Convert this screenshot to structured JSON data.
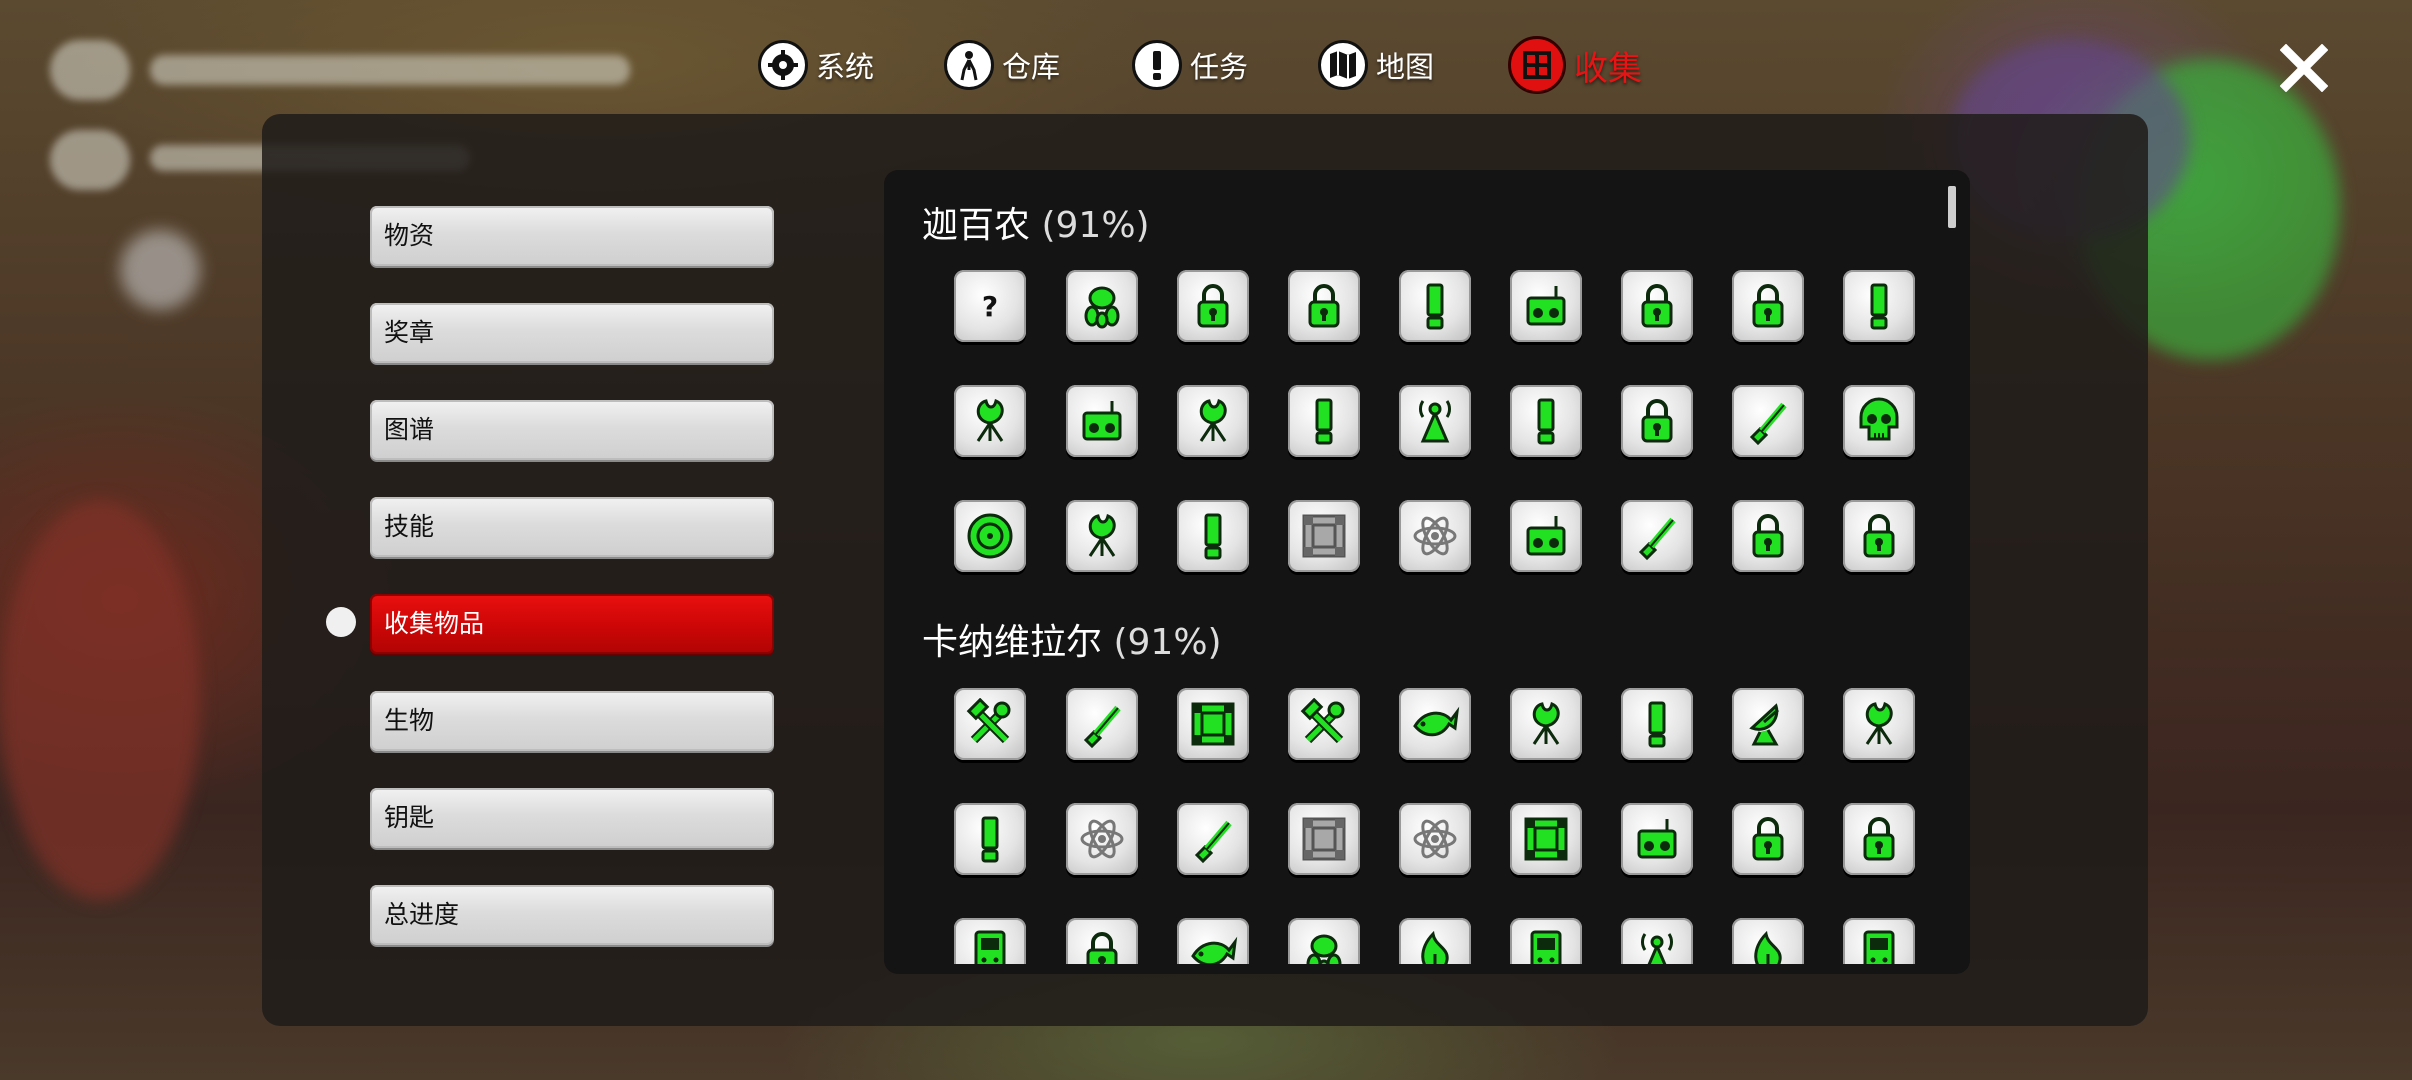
{
  "topnav": {
    "items": [
      {
        "label": "系统",
        "icon": "gear-icon"
      },
      {
        "label": "仓库",
        "icon": "person-icon"
      },
      {
        "label": "任务",
        "icon": "exclamation-icon"
      },
      {
        "label": "地图",
        "icon": "map-icon"
      },
      {
        "label": "收集",
        "icon": "collection-icon",
        "active": true
      }
    ],
    "close_label": "X"
  },
  "sidebar": {
    "items": [
      {
        "label": "物资"
      },
      {
        "label": "奖章"
      },
      {
        "label": "图谱"
      },
      {
        "label": "技能"
      },
      {
        "label": "收集物品",
        "active": true
      },
      {
        "label": "生物"
      },
      {
        "label": "钥匙"
      },
      {
        "label": "总进度"
      }
    ]
  },
  "colors": {
    "accent": "#e01010",
    "icon_green": "#22e022",
    "panel": "#201c1a"
  },
  "sections": [
    {
      "name": "迦百农",
      "percent": "(91%)",
      "rows": [
        [
          "question",
          "creature",
          "lock",
          "lock",
          "exclaim",
          "radio",
          "lock",
          "lock",
          "exclaim"
        ],
        [
          "plant",
          "radio",
          "plant",
          "exclaim",
          "antenna",
          "exclaim",
          "lock",
          "shovel",
          "skull"
        ],
        [
          "disc",
          "plant",
          "exclaim",
          "frame-gray",
          "atom-gray",
          "radio",
          "shovel",
          "lock",
          "lock"
        ]
      ]
    },
    {
      "name": "卡纳维拉尔",
      "percent": "(91%)",
      "rows": [
        [
          "tools",
          "shovel",
          "frame",
          "tools",
          "fish",
          "plant",
          "exclaim",
          "dish",
          "plant"
        ],
        [
          "exclaim",
          "atom-gray",
          "shovel",
          "frame-gray",
          "atom-gray",
          "frame",
          "radio",
          "lock",
          "lock"
        ],
        [
          "device",
          "lock",
          "fish",
          "creature",
          "leaf",
          "device",
          "antenna",
          "leaf",
          "device"
        ]
      ]
    }
  ]
}
